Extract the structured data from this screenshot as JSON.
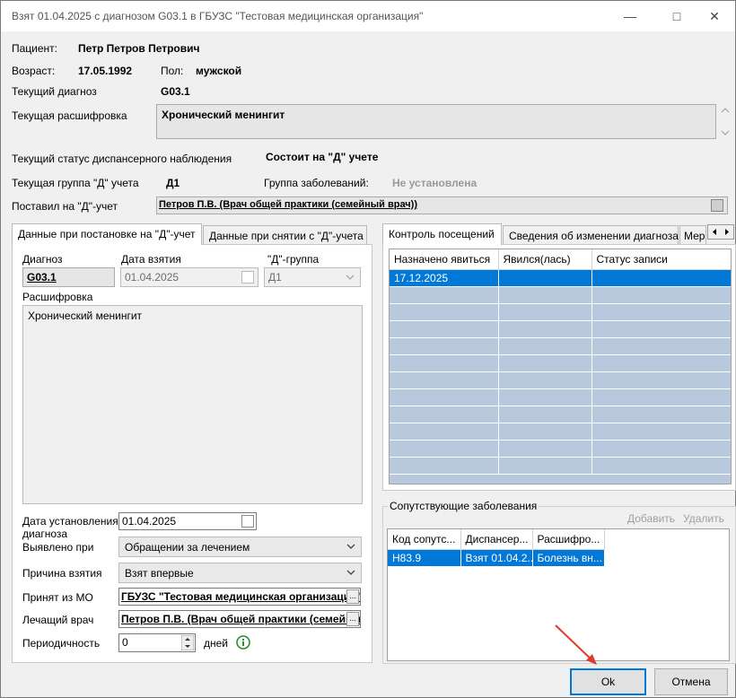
{
  "window": {
    "title": "Взят 01.04.2025 с диагнозом G03.1 в ГБУЗС \"Тестовая медицинская организация\""
  },
  "header": {
    "patient_label": "Пациент:",
    "patient_name": "Петр Петров Петрович",
    "age_label": "Возраст:",
    "birth_date": "17.05.1992",
    "sex_label": "Пол:",
    "sex_value": "мужской",
    "current_diagnosis_label": "Текущий диагноз",
    "current_diagnosis_value": "G03.1",
    "decoding_label": "Текущая расшифровка",
    "decoding_value": "Хронический менингит",
    "status_label": "Текущий статус диспансерного наблюдения",
    "status_value": "Состоит на \"Д\" учете",
    "d_group_label": "Текущая группа \"Д\" учета",
    "d_group_value": "Д1",
    "disease_group_label": "Группа заболеваний:",
    "disease_group_value": "Не установлена",
    "registered_by_label": "Поставил на \"Д\"-учет",
    "registered_by_value": "Петров П.В. (Врач общей практики (семейный врач))"
  },
  "left_tabs": [
    {
      "label": "Данные при постановке на \"Д\"-учет"
    },
    {
      "label": "Данные при снятии с \"Д\"-учета"
    }
  ],
  "left_form": {
    "diagnosis_label": "Диагноз",
    "diagnosis_value": "G03.1",
    "date_taken_label": "Дата взятия",
    "date_taken_value": "01.04.2025",
    "d_group_label": "\"Д\"-группа",
    "d_group_value": "Д1",
    "decoding_label": "Расшифровка",
    "decoding_value": "Хронический менингит",
    "diag_date_label_1": "Дата установления",
    "diag_date_label_2": "диагноза",
    "diag_date_value": "01.04.2025",
    "detected_label": "Выявлено при",
    "detected_value": "Обращении за лечением",
    "reason_label": "Причина взятия",
    "reason_value": "Взят впервые",
    "from_mo_label": "Принят из МО",
    "from_mo_value": "ГБУЗС \"Тестовая медицинская организация\"",
    "doctor_label": "Лечащий врач",
    "doctor_value": "Петров П.В. (Врач общей практики (семейный врач))",
    "periodicity_label": "Периодичность",
    "periodicity_value": "0",
    "days_label": "дней"
  },
  "right_tabs": [
    {
      "label": "Контроль посещений"
    },
    {
      "label": "Сведения об изменении диагноза"
    },
    {
      "label": "Мер"
    }
  ],
  "visits_table": {
    "columns": [
      "Назначено явиться",
      "Явился(лась)",
      "Статус записи"
    ],
    "rows": [
      [
        "17.12.2025",
        "",
        ""
      ]
    ]
  },
  "comorbid": {
    "title": "Сопутствующие заболевания",
    "add_label": "Добавить",
    "delete_label": "Удалить",
    "columns": [
      "Код сопутс...",
      "Диспансер...",
      "Расшифро..."
    ],
    "rows": [
      [
        "H83.9",
        "Взят 01.04.2...",
        "Болезнь вн..."
      ]
    ]
  },
  "footer": {
    "ok_label": "Ok",
    "cancel_label": "Отмена"
  },
  "colors": {
    "selection": "#0078d7",
    "grid_empty": "#b8c9dd",
    "info_icon": "#2e8b2e",
    "arrow": "#e03a2f"
  }
}
